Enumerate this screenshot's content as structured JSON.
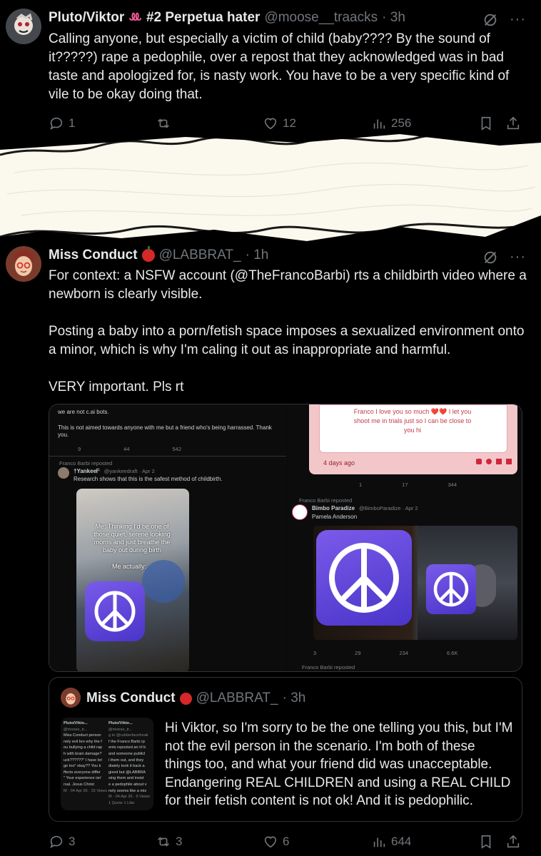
{
  "tweet1": {
    "display_name": "Pluto/Viktor",
    "name_suffix": "#2 Perpetua hater",
    "handle": "@moose__traacks",
    "time": "· 3h",
    "text": "Calling anyone, but especially a victim of child (baby???? By the sound of it?????) rape a pedophile, over a repost that they acknowledged was in bad taste and apologized for, is nasty work. You have to be a very specific kind of vile to be okay doing that.",
    "replies": "1",
    "reposts": "",
    "likes": "12",
    "views": "256"
  },
  "tweet2": {
    "display_name": "Miss Conduct",
    "handle": "@LABBRAT_",
    "time": "· 1h",
    "paragraphs": [
      "For context: a NSFW  account (@TheFrancoBarbi) rts a childbirth video where a newborn is clearly visible.",
      "Posting a baby into a porn/fetish space imposes a sexualized environment onto a minor, which is why I'm caling it out as inappropriate and harmful.",
      "VERY important. Pls rt"
    ],
    "media": {
      "left": {
        "top_text_1": "we are not c.ai bots.",
        "top_text_2": "This is not aimed towards anyone with me but a friend who's being harrassed. Thank you.",
        "stats": [
          "",
          "9",
          "44",
          "542"
        ],
        "reposted_by": "Franco Barbi reposted",
        "author": "†Yankeeᖴ",
        "author_handle": "@yankeedraft · Apr 2",
        "post_text": "Research shows that this is the safest method of childbirth.",
        "meme_text": "Me:  Thinking I'd be one of those quiet, serene looking moms and just breathe the baby out during birth",
        "meme_text_2": "Me actually:"
      },
      "right_top": {
        "card_text": "Franco I love you so much ❤️❤️ I let you shoot me in trials just so I can be close to you hi",
        "card_date": "4 days ago",
        "stats": [
          "1",
          "17",
          "344"
        ]
      },
      "right_bottom": {
        "reposted_by": "Franco Barbi reposted",
        "author": "Bimbo Paradize",
        "author_handle": "@BimboParadize · Apr 2",
        "post_text": "Pamela Anderson",
        "stats": [
          "3",
          "29",
          "234",
          "6.6K"
        ],
        "footer": "Franco Barbi reposted"
      }
    },
    "quote": {
      "display_name": "Miss Conduct",
      "handle": "@LABBRAT_",
      "time": "· 3h",
      "text": "Hi Viktor, so I'm sorry to be the one telling you this, but I'M not the evil person in the scenario. I'm both of these things too, and what your friend did was unacceptable. Endangering REAL CHILDREN and using a REAL CHILD for their fetish content is not ok! And it is pedophilic.",
      "thumb_left": [
        "Pluto/Vikto...",
        "@moose_tr...",
        "Miss Conduct person",
        "nely evil bro why the f",
        "ou bullying a child rap",
        "h with brain damage?",
        "uck??????\" I have bri",
        "ge too\" okay?? You k",
        "ffects everyone differ",
        "\" Your experience isn'",
        "rsal. Jesus Christ",
        "M · 04 Apr 26 · 15 Views"
      ],
      "thumb_right": [
        "Pluto/Vikto...",
        "@moose_tr...",
        "g to @rubberfacefreak",
        "f the Franco Barbi rp",
        "ents reposted an irl b",
        "and someone publicl",
        "l them out, and they",
        "diately took it back a",
        "gized but @LABBRA",
        "sing them and insist",
        "e a pedophile about v",
        "nely seems like a mis",
        "M · 04 Apr 26 · 9 Views",
        "1 Quote  1 Like"
      ]
    },
    "replies": "3",
    "reposts": "3",
    "likes": "6",
    "views": "644"
  }
}
